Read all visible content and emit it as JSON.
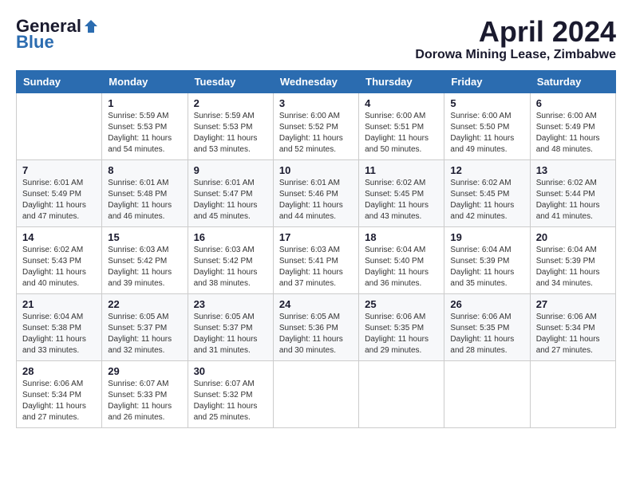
{
  "logo": {
    "general": "General",
    "blue": "Blue"
  },
  "title": {
    "month": "April 2024",
    "location": "Dorowa Mining Lease, Zimbabwe"
  },
  "weekdays": [
    "Sunday",
    "Monday",
    "Tuesday",
    "Wednesday",
    "Thursday",
    "Friday",
    "Saturday"
  ],
  "weeks": [
    [
      {
        "day": "",
        "sunrise": "",
        "sunset": "",
        "daylight": ""
      },
      {
        "day": "1",
        "sunrise": "Sunrise: 5:59 AM",
        "sunset": "Sunset: 5:53 PM",
        "daylight": "Daylight: 11 hours and 54 minutes."
      },
      {
        "day": "2",
        "sunrise": "Sunrise: 5:59 AM",
        "sunset": "Sunset: 5:53 PM",
        "daylight": "Daylight: 11 hours and 53 minutes."
      },
      {
        "day": "3",
        "sunrise": "Sunrise: 6:00 AM",
        "sunset": "Sunset: 5:52 PM",
        "daylight": "Daylight: 11 hours and 52 minutes."
      },
      {
        "day": "4",
        "sunrise": "Sunrise: 6:00 AM",
        "sunset": "Sunset: 5:51 PM",
        "daylight": "Daylight: 11 hours and 50 minutes."
      },
      {
        "day": "5",
        "sunrise": "Sunrise: 6:00 AM",
        "sunset": "Sunset: 5:50 PM",
        "daylight": "Daylight: 11 hours and 49 minutes."
      },
      {
        "day": "6",
        "sunrise": "Sunrise: 6:00 AM",
        "sunset": "Sunset: 5:49 PM",
        "daylight": "Daylight: 11 hours and 48 minutes."
      }
    ],
    [
      {
        "day": "7",
        "sunrise": "Sunrise: 6:01 AM",
        "sunset": "Sunset: 5:49 PM",
        "daylight": "Daylight: 11 hours and 47 minutes."
      },
      {
        "day": "8",
        "sunrise": "Sunrise: 6:01 AM",
        "sunset": "Sunset: 5:48 PM",
        "daylight": "Daylight: 11 hours and 46 minutes."
      },
      {
        "day": "9",
        "sunrise": "Sunrise: 6:01 AM",
        "sunset": "Sunset: 5:47 PM",
        "daylight": "Daylight: 11 hours and 45 minutes."
      },
      {
        "day": "10",
        "sunrise": "Sunrise: 6:01 AM",
        "sunset": "Sunset: 5:46 PM",
        "daylight": "Daylight: 11 hours and 44 minutes."
      },
      {
        "day": "11",
        "sunrise": "Sunrise: 6:02 AM",
        "sunset": "Sunset: 5:45 PM",
        "daylight": "Daylight: 11 hours and 43 minutes."
      },
      {
        "day": "12",
        "sunrise": "Sunrise: 6:02 AM",
        "sunset": "Sunset: 5:45 PM",
        "daylight": "Daylight: 11 hours and 42 minutes."
      },
      {
        "day": "13",
        "sunrise": "Sunrise: 6:02 AM",
        "sunset": "Sunset: 5:44 PM",
        "daylight": "Daylight: 11 hours and 41 minutes."
      }
    ],
    [
      {
        "day": "14",
        "sunrise": "Sunrise: 6:02 AM",
        "sunset": "Sunset: 5:43 PM",
        "daylight": "Daylight: 11 hours and 40 minutes."
      },
      {
        "day": "15",
        "sunrise": "Sunrise: 6:03 AM",
        "sunset": "Sunset: 5:42 PM",
        "daylight": "Daylight: 11 hours and 39 minutes."
      },
      {
        "day": "16",
        "sunrise": "Sunrise: 6:03 AM",
        "sunset": "Sunset: 5:42 PM",
        "daylight": "Daylight: 11 hours and 38 minutes."
      },
      {
        "day": "17",
        "sunrise": "Sunrise: 6:03 AM",
        "sunset": "Sunset: 5:41 PM",
        "daylight": "Daylight: 11 hours and 37 minutes."
      },
      {
        "day": "18",
        "sunrise": "Sunrise: 6:04 AM",
        "sunset": "Sunset: 5:40 PM",
        "daylight": "Daylight: 11 hours and 36 minutes."
      },
      {
        "day": "19",
        "sunrise": "Sunrise: 6:04 AM",
        "sunset": "Sunset: 5:39 PM",
        "daylight": "Daylight: 11 hours and 35 minutes."
      },
      {
        "day": "20",
        "sunrise": "Sunrise: 6:04 AM",
        "sunset": "Sunset: 5:39 PM",
        "daylight": "Daylight: 11 hours and 34 minutes."
      }
    ],
    [
      {
        "day": "21",
        "sunrise": "Sunrise: 6:04 AM",
        "sunset": "Sunset: 5:38 PM",
        "daylight": "Daylight: 11 hours and 33 minutes."
      },
      {
        "day": "22",
        "sunrise": "Sunrise: 6:05 AM",
        "sunset": "Sunset: 5:37 PM",
        "daylight": "Daylight: 11 hours and 32 minutes."
      },
      {
        "day": "23",
        "sunrise": "Sunrise: 6:05 AM",
        "sunset": "Sunset: 5:37 PM",
        "daylight": "Daylight: 11 hours and 31 minutes."
      },
      {
        "day": "24",
        "sunrise": "Sunrise: 6:05 AM",
        "sunset": "Sunset: 5:36 PM",
        "daylight": "Daylight: 11 hours and 30 minutes."
      },
      {
        "day": "25",
        "sunrise": "Sunrise: 6:06 AM",
        "sunset": "Sunset: 5:35 PM",
        "daylight": "Daylight: 11 hours and 29 minutes."
      },
      {
        "day": "26",
        "sunrise": "Sunrise: 6:06 AM",
        "sunset": "Sunset: 5:35 PM",
        "daylight": "Daylight: 11 hours and 28 minutes."
      },
      {
        "day": "27",
        "sunrise": "Sunrise: 6:06 AM",
        "sunset": "Sunset: 5:34 PM",
        "daylight": "Daylight: 11 hours and 27 minutes."
      }
    ],
    [
      {
        "day": "28",
        "sunrise": "Sunrise: 6:06 AM",
        "sunset": "Sunset: 5:34 PM",
        "daylight": "Daylight: 11 hours and 27 minutes."
      },
      {
        "day": "29",
        "sunrise": "Sunrise: 6:07 AM",
        "sunset": "Sunset: 5:33 PM",
        "daylight": "Daylight: 11 hours and 26 minutes."
      },
      {
        "day": "30",
        "sunrise": "Sunrise: 6:07 AM",
        "sunset": "Sunset: 5:32 PM",
        "daylight": "Daylight: 11 hours and 25 minutes."
      },
      {
        "day": "",
        "sunrise": "",
        "sunset": "",
        "daylight": ""
      },
      {
        "day": "",
        "sunrise": "",
        "sunset": "",
        "daylight": ""
      },
      {
        "day": "",
        "sunrise": "",
        "sunset": "",
        "daylight": ""
      },
      {
        "day": "",
        "sunrise": "",
        "sunset": "",
        "daylight": ""
      }
    ]
  ]
}
